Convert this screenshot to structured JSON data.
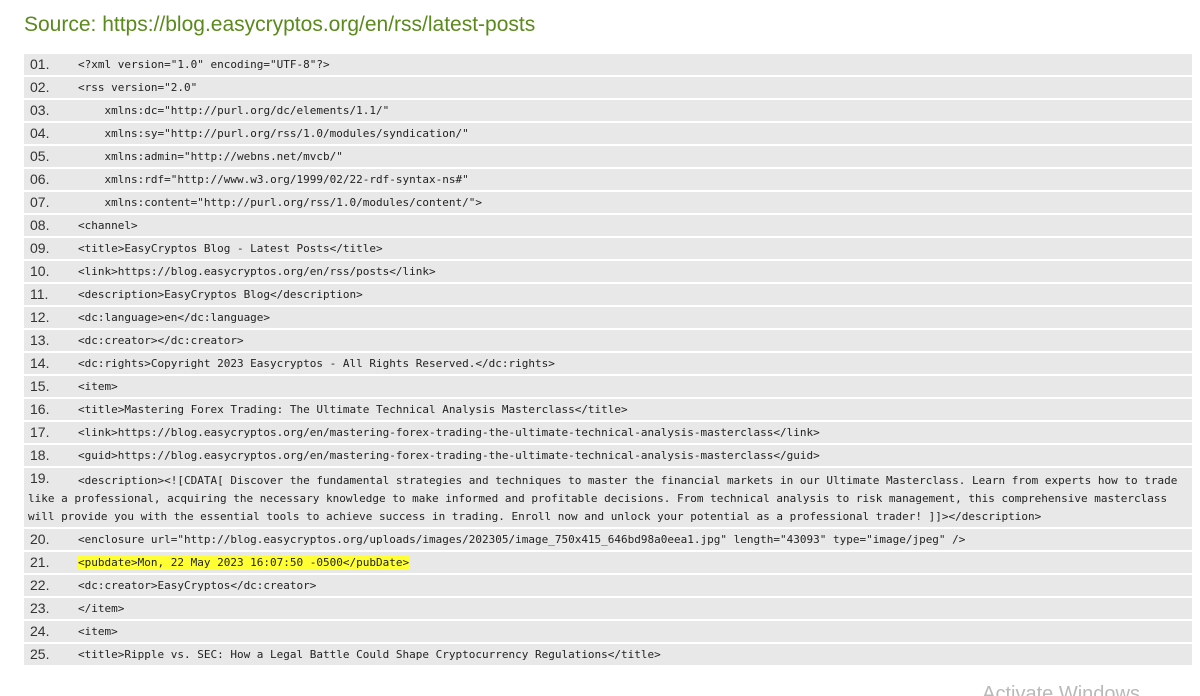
{
  "source": {
    "label": "Source: https://blog.easycryptos.org/en/rss/latest-posts"
  },
  "lines": [
    {
      "num": "01.",
      "code": "<?xml version=\"1.0\" encoding=\"UTF-8\"?>"
    },
    {
      "num": "02.",
      "code": "<rss version=\"2.0\""
    },
    {
      "num": "03.",
      "code": "    xmlns:dc=\"http://purl.org/dc/elements/1.1/\""
    },
    {
      "num": "04.",
      "code": "    xmlns:sy=\"http://purl.org/rss/1.0/modules/syndication/\""
    },
    {
      "num": "05.",
      "code": "    xmlns:admin=\"http://webns.net/mvcb/\""
    },
    {
      "num": "06.",
      "code": "    xmlns:rdf=\"http://www.w3.org/1999/02/22-rdf-syntax-ns#\""
    },
    {
      "num": "07.",
      "code": "    xmlns:content=\"http://purl.org/rss/1.0/modules/content/\">"
    },
    {
      "num": "08.",
      "code": "<channel>"
    },
    {
      "num": "09.",
      "code": "<title>EasyCryptos Blog - Latest Posts</title>"
    },
    {
      "num": "10.",
      "code": "<link>https://blog.easycryptos.org/en/rss/posts</link>"
    },
    {
      "num": "11.",
      "code": "<description>EasyCryptos Blog</description>"
    },
    {
      "num": "12.",
      "code": "<dc:language>en</dc:language>"
    },
    {
      "num": "13.",
      "code": "<dc:creator></dc:creator>"
    },
    {
      "num": "14.",
      "code": "<dc:rights>Copyright 2023 Easycryptos - All Rights Reserved.</dc:rights>"
    },
    {
      "num": "15.",
      "code": "<item>"
    },
    {
      "num": "16.",
      "code": "<title>Mastering Forex Trading: The Ultimate Technical Analysis Masterclass</title>"
    },
    {
      "num": "17.",
      "code": "<link>https://blog.easycryptos.org/en/mastering-forex-trading-the-ultimate-technical-analysis-masterclass</link>"
    },
    {
      "num": "18.",
      "code": "<guid>https://blog.easycryptos.org/en/mastering-forex-trading-the-ultimate-technical-analysis-masterclass</guid>"
    },
    {
      "num": "19.",
      "code": "<description><![CDATA[ Discover the fundamental strategies and techniques to master the financial markets in our Ultimate Masterclass. Learn from experts how to trade like a professional, acquiring the necessary knowledge to make informed and profitable decisions. From technical analysis to risk management, this comprehensive masterclass will provide you with the essential tools to achieve success in trading. Enroll now and unlock your potential as a professional trader! ]]></description>",
      "wrap": true
    },
    {
      "num": "20.",
      "code": "<enclosure url=\"http://blog.easycryptos.org/uploads/images/202305/image_750x415_646bd98a0eea1.jpg\" length=\"43093\" type=\"image/jpeg\" />"
    },
    {
      "num": "21.",
      "code": "<pubdate>Mon, 22 May 2023 16:07:50 -0500</pubDate>",
      "highlight": true
    },
    {
      "num": "22.",
      "code": "<dc:creator>EasyCryptos</dc:creator>"
    },
    {
      "num": "23.",
      "code": "</item>"
    },
    {
      "num": "24.",
      "code": "<item>"
    },
    {
      "num": "25.",
      "code": "<title>Ripple vs. SEC: How a Legal Battle Could Shape Cryptocurrency Regulations</title>"
    }
  ],
  "watermark": "Activate Windows",
  "colors": {
    "title_green": "#5a8a1c",
    "line_background": "#e8e8e8",
    "highlight": "#ffff33"
  }
}
